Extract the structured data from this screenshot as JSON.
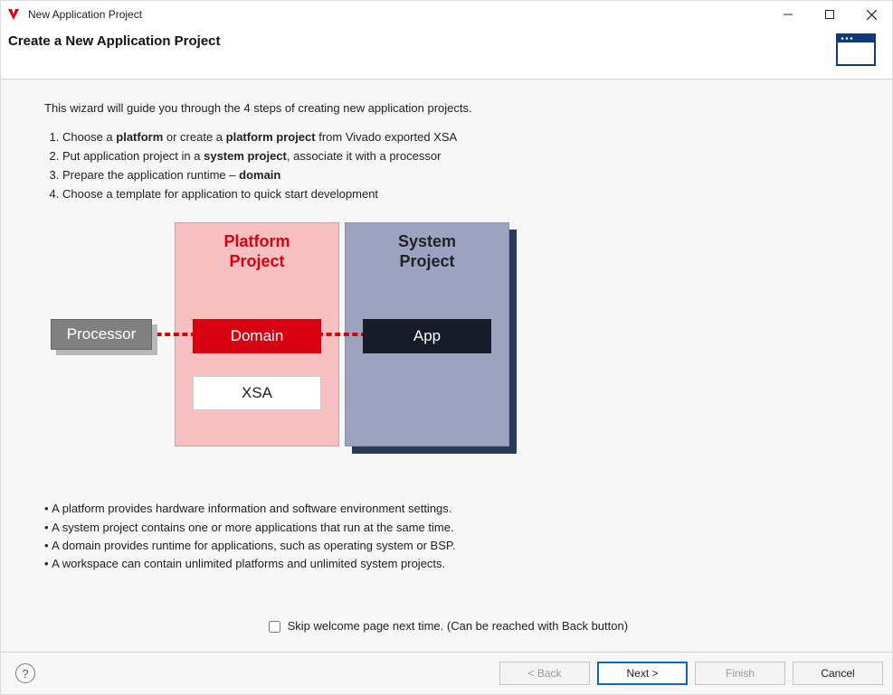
{
  "window": {
    "title": "New Application Project"
  },
  "header": {
    "heading": "Create a New Application Project"
  },
  "intro": "This wizard will guide you through the 4 steps of creating new application projects.",
  "steps": [
    {
      "pre": "Choose a ",
      "b1": "platform",
      "mid": " or create a ",
      "b2": "platform project",
      "post": " from Vivado exported XSA"
    },
    {
      "pre": "Put application project in a ",
      "b1": "system project",
      "mid": ", associate it with a processor",
      "b2": "",
      "post": ""
    },
    {
      "pre": "Prepare the application runtime – ",
      "b1": "domain",
      "mid": "",
      "b2": "",
      "post": ""
    },
    {
      "pre": "Choose a template for application to quick start development",
      "b1": "",
      "mid": "",
      "b2": "",
      "post": ""
    }
  ],
  "diagram": {
    "platform_title_l1": "Platform",
    "platform_title_l2": "Project",
    "system_title_l1": "System",
    "system_title_l2": "Project",
    "processor": "Processor",
    "domain": "Domain",
    "app": "App",
    "xsa": "XSA"
  },
  "bullets": [
    "A platform provides hardware information and software environment settings.",
    "A system project contains one or more applications that run at the same time.",
    "A domain provides runtime for applications, such as operating system or BSP.",
    "A workspace can contain unlimited platforms and unlimited system projects."
  ],
  "skip": {
    "label": "Skip welcome page next time. (Can be reached with Back button)",
    "checked": false
  },
  "buttons": {
    "back": "< Back",
    "next": "Next >",
    "finish": "Finish",
    "cancel": "Cancel"
  }
}
